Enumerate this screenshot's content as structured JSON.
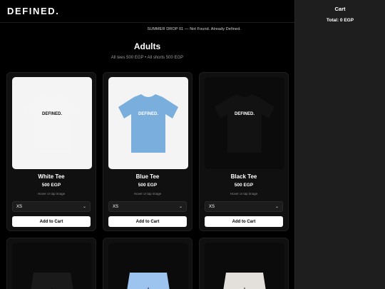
{
  "header": {
    "logo": "DEFINED."
  },
  "banner": "SUMMER DROP 01 — Not Found. Already Defined.",
  "section": {
    "title": "Adults",
    "subtitle": "All tees 500 EGP • All shorts 500 EGP"
  },
  "products": [
    {
      "name": "White Tee",
      "price": "500 EGP",
      "hint": "Hover or tap image",
      "size": "XS",
      "button": "Add to Cart",
      "shirt_color": "#f5f5f5",
      "print_color": "#111111",
      "print": "DEFINED."
    },
    {
      "name": "Blue Tee",
      "price": "500 EGP",
      "hint": "Hover or tap image",
      "size": "XS",
      "button": "Add to Cart",
      "shirt_color": "#7aaedd",
      "print_color": "#ffffff",
      "print": "DEFINED."
    },
    {
      "name": "Black Tee",
      "price": "500 EGP",
      "hint": "Hover or tap image",
      "size": "XS",
      "button": "Add to Cart",
      "shirt_color": "#121212",
      "print_color": "#ffffff",
      "print": "DEFINED."
    }
  ],
  "shorts": [
    {
      "color": "#1a1a1a"
    },
    {
      "color": "#9cc4ee"
    },
    {
      "color": "#e3e0dc"
    }
  ],
  "cart": {
    "title": "Cart",
    "total": "Total: 0 EGP"
  }
}
